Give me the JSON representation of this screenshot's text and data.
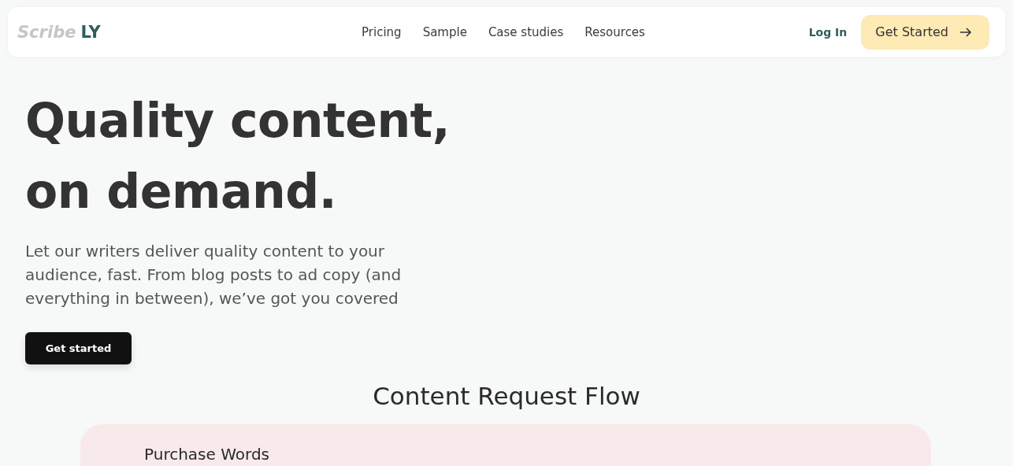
{
  "header": {
    "logo": {
      "light": "Scribe",
      "strong": "LY"
    },
    "nav": [
      "Pricing",
      "Sample",
      "Case studies",
      "Resources"
    ],
    "login": "Log In",
    "cta": "Get Started"
  },
  "hero": {
    "title_lines": [
      "Quality content,",
      "on demand."
    ],
    "subtitle": "Let our writers deliver quality content to your audience, fast. From blog posts to ad copy (and everything in between), we’ve got you covered",
    "button": "Get started"
  },
  "flow": {
    "title": "Content Request Flow",
    "steps": [
      {
        "title": "Purchase Words"
      }
    ]
  }
}
